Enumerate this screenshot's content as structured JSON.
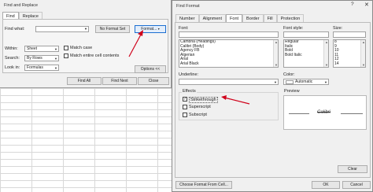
{
  "find_replace": {
    "title": "Find and Replace",
    "tabs": [
      "Find",
      "Replace"
    ],
    "find_what_label": "Find what:",
    "find_what_value": "",
    "no_format_set": "No Format Set",
    "format_button": "Format...",
    "within_label": "Within:",
    "within_value": "Sheet",
    "search_label": "Search:",
    "search_value": "By Rows",
    "look_in_label": "Look in:",
    "look_in_value": "Formulas",
    "match_case": "Match case",
    "match_entire": "Match entire cell contents",
    "options_button": "Options <<",
    "find_all": "Find All",
    "find_next": "Find Next",
    "close": "Close"
  },
  "find_format": {
    "title": "Find Format",
    "help_icon": "?",
    "close_icon": "✕",
    "tabs": [
      "Number",
      "Alignment",
      "Font",
      "Border",
      "Fill",
      "Protection"
    ],
    "active_tab": "Font",
    "font_label": "Font:",
    "font_value": "",
    "fonts": [
      "Cambria (Headings)",
      "Calibri (Body)",
      "Agency FB",
      "Algerian",
      "Arial",
      "Arial Black"
    ],
    "font_style_label": "Font style:",
    "font_style_value": "",
    "font_styles": [
      "Regular",
      "Italic",
      "Bold",
      "Bold Italic"
    ],
    "size_label": "Size:",
    "size_value": "",
    "sizes": [
      "8",
      "9",
      "10",
      "11",
      "12",
      "14"
    ],
    "underline_label": "Underline:",
    "underline_value": "",
    "color_label": "Color:",
    "color_value": "Automatic",
    "effects_label": "Effects",
    "strikethrough": "Strikethrough",
    "superscript": "Superscript",
    "subscript": "Subscript",
    "preview_label": "Preview",
    "preview_text": "Calibri",
    "clear_button": "Clear",
    "choose_format_button": "Choose Format From Cell...",
    "ok_button": "OK",
    "cancel_button": "Cancel"
  },
  "colors": {
    "accent": "#1c6fd1",
    "arrow": "#d0021b"
  }
}
